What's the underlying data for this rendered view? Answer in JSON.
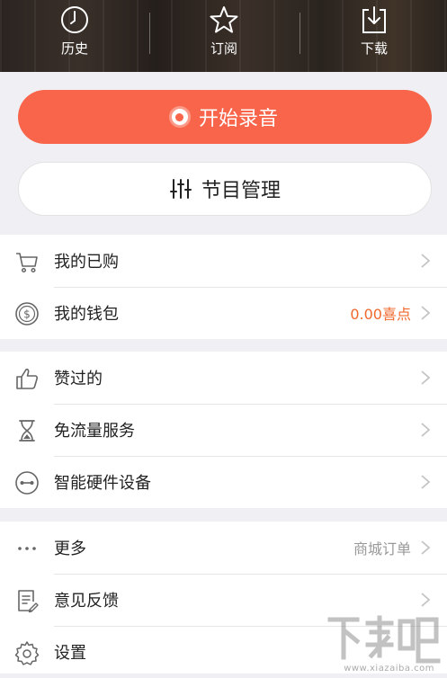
{
  "top_nav": {
    "items": [
      {
        "label": "历史",
        "icon": "clock-icon"
      },
      {
        "label": "订阅",
        "icon": "star-icon"
      },
      {
        "label": "下载",
        "icon": "download-icon"
      }
    ]
  },
  "actions": {
    "record_label": "开始录音",
    "program_label": "节目管理"
  },
  "group1": [
    {
      "label": "我的已购",
      "icon": "cart-icon",
      "value": ""
    },
    {
      "label": "我的钱包",
      "icon": "wallet-coin-icon",
      "value": "0.00喜点"
    }
  ],
  "group2": [
    {
      "label": "赞过的",
      "icon": "thumbs-up-icon",
      "value": ""
    },
    {
      "label": "免流量服务",
      "icon": "hourglass-icon",
      "value": ""
    },
    {
      "label": "智能硬件设备",
      "icon": "device-link-icon",
      "value": ""
    }
  ],
  "group3": [
    {
      "label": "更多",
      "icon": "more-dots-icon",
      "value": "商城订单"
    },
    {
      "label": "意见反馈",
      "icon": "feedback-icon",
      "value": ""
    },
    {
      "label": "设置",
      "icon": "gear-icon",
      "value": ""
    }
  ],
  "watermark": {
    "url": "www.xiazaiba.com",
    "logo_text": "下载吧"
  },
  "colors": {
    "accent": "#f8654a",
    "wallet_value": "#f0682c",
    "background": "#efeff4"
  }
}
